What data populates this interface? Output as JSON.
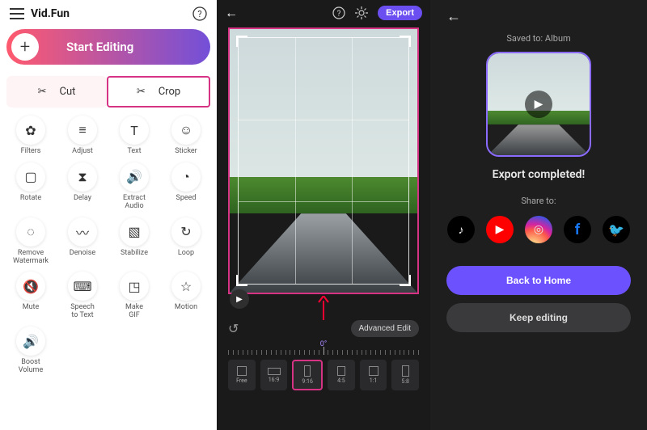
{
  "app": {
    "title": "Vid.Fun",
    "startEditing": "Start Editing"
  },
  "tabs": {
    "cut": "Cut",
    "crop": "Crop"
  },
  "tools": [
    {
      "id": "filters",
      "label": "Filters",
      "glyph": "✿"
    },
    {
      "id": "adjust",
      "label": "Adjust",
      "glyph": "≡"
    },
    {
      "id": "text",
      "label": "Text",
      "glyph": "T"
    },
    {
      "id": "sticker",
      "label": "Sticker",
      "glyph": "☺"
    },
    {
      "id": "rotate",
      "label": "Rotate",
      "glyph": "▢"
    },
    {
      "id": "delay",
      "label": "Delay",
      "glyph": "⧗"
    },
    {
      "id": "extract-audio",
      "label": "Extract Audio",
      "glyph": "🔊"
    },
    {
      "id": "speed",
      "label": "Speed",
      "glyph": "◔"
    },
    {
      "id": "remove-watermark",
      "label": "Remove Watermark",
      "glyph": "◌"
    },
    {
      "id": "denoise",
      "label": "Denoise",
      "glyph": "〰"
    },
    {
      "id": "stabilize",
      "label": "Stabilize",
      "glyph": "▧"
    },
    {
      "id": "loop",
      "label": "Loop",
      "glyph": "↻"
    },
    {
      "id": "mute",
      "label": "Mute",
      "glyph": "🔇"
    },
    {
      "id": "speech-to-text",
      "label": "Speech to Text",
      "glyph": "⌨"
    },
    {
      "id": "make-gif",
      "label": "Make GIF",
      "glyph": "◳"
    },
    {
      "id": "motion",
      "label": "Motion",
      "glyph": "☆"
    },
    {
      "id": "boost-volume",
      "label": "Boost Volume",
      "glyph": "🔊"
    }
  ],
  "editor": {
    "export": "Export",
    "advanced": "Advanced Edit",
    "rulerCenter": "0°",
    "aspects": [
      {
        "id": "free",
        "label": "Free",
        "w": 12,
        "h": 12
      },
      {
        "id": "16-9",
        "label": "16:9",
        "w": 16,
        "h": 9
      },
      {
        "id": "9-16",
        "label": "9:16",
        "w": 8,
        "h": 14,
        "selected": true
      },
      {
        "id": "4-5",
        "label": "4:5",
        "w": 10,
        "h": 12
      },
      {
        "id": "1-1",
        "label": "1:1",
        "w": 12,
        "h": 12
      },
      {
        "id": "5-8",
        "label": "5:8",
        "w": 9,
        "h": 14
      }
    ]
  },
  "exportPanel": {
    "savedTo": "Saved to: Album",
    "done": "Export completed!",
    "shareTo": "Share to:",
    "backHome": "Back to Home",
    "keepEditing": "Keep editing",
    "shares": [
      {
        "id": "tiktok",
        "glyph": "♪"
      },
      {
        "id": "youtube",
        "glyph": "▶"
      },
      {
        "id": "instagram",
        "glyph": "◎"
      },
      {
        "id": "facebook",
        "glyph": "f"
      },
      {
        "id": "twitter",
        "glyph": "🐦"
      }
    ]
  }
}
